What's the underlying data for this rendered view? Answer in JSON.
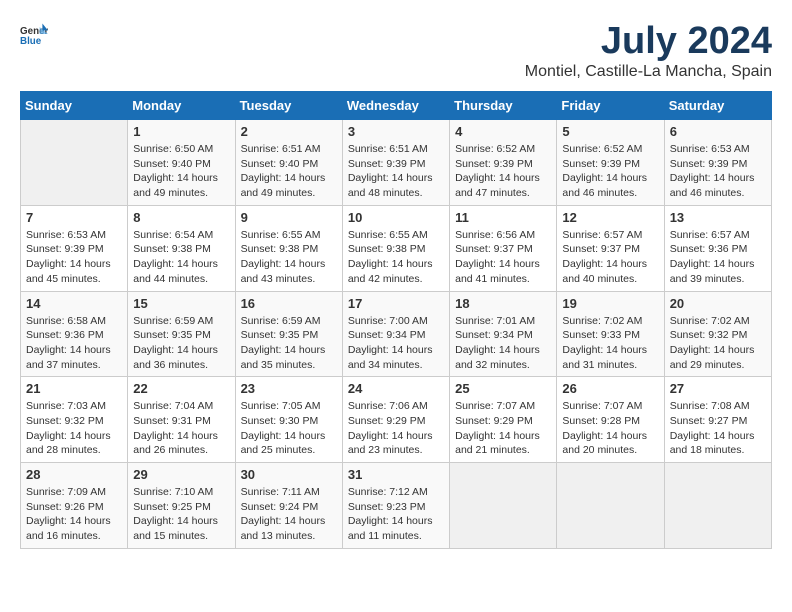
{
  "header": {
    "logo_general": "General",
    "logo_blue": "Blue",
    "month_year": "July 2024",
    "location": "Montiel, Castille-La Mancha, Spain"
  },
  "calendar": {
    "days_of_week": [
      "Sunday",
      "Monday",
      "Tuesday",
      "Wednesday",
      "Thursday",
      "Friday",
      "Saturday"
    ],
    "weeks": [
      [
        {
          "day": "",
          "info": ""
        },
        {
          "day": "1",
          "info": "Sunrise: 6:50 AM\nSunset: 9:40 PM\nDaylight: 14 hours\nand 49 minutes."
        },
        {
          "day": "2",
          "info": "Sunrise: 6:51 AM\nSunset: 9:40 PM\nDaylight: 14 hours\nand 49 minutes."
        },
        {
          "day": "3",
          "info": "Sunrise: 6:51 AM\nSunset: 9:39 PM\nDaylight: 14 hours\nand 48 minutes."
        },
        {
          "day": "4",
          "info": "Sunrise: 6:52 AM\nSunset: 9:39 PM\nDaylight: 14 hours\nand 47 minutes."
        },
        {
          "day": "5",
          "info": "Sunrise: 6:52 AM\nSunset: 9:39 PM\nDaylight: 14 hours\nand 46 minutes."
        },
        {
          "day": "6",
          "info": "Sunrise: 6:53 AM\nSunset: 9:39 PM\nDaylight: 14 hours\nand 46 minutes."
        }
      ],
      [
        {
          "day": "7",
          "info": "Sunrise: 6:53 AM\nSunset: 9:39 PM\nDaylight: 14 hours\nand 45 minutes."
        },
        {
          "day": "8",
          "info": "Sunrise: 6:54 AM\nSunset: 9:38 PM\nDaylight: 14 hours\nand 44 minutes."
        },
        {
          "day": "9",
          "info": "Sunrise: 6:55 AM\nSunset: 9:38 PM\nDaylight: 14 hours\nand 43 minutes."
        },
        {
          "day": "10",
          "info": "Sunrise: 6:55 AM\nSunset: 9:38 PM\nDaylight: 14 hours\nand 42 minutes."
        },
        {
          "day": "11",
          "info": "Sunrise: 6:56 AM\nSunset: 9:37 PM\nDaylight: 14 hours\nand 41 minutes."
        },
        {
          "day": "12",
          "info": "Sunrise: 6:57 AM\nSunset: 9:37 PM\nDaylight: 14 hours\nand 40 minutes."
        },
        {
          "day": "13",
          "info": "Sunrise: 6:57 AM\nSunset: 9:36 PM\nDaylight: 14 hours\nand 39 minutes."
        }
      ],
      [
        {
          "day": "14",
          "info": "Sunrise: 6:58 AM\nSunset: 9:36 PM\nDaylight: 14 hours\nand 37 minutes."
        },
        {
          "day": "15",
          "info": "Sunrise: 6:59 AM\nSunset: 9:35 PM\nDaylight: 14 hours\nand 36 minutes."
        },
        {
          "day": "16",
          "info": "Sunrise: 6:59 AM\nSunset: 9:35 PM\nDaylight: 14 hours\nand 35 minutes."
        },
        {
          "day": "17",
          "info": "Sunrise: 7:00 AM\nSunset: 9:34 PM\nDaylight: 14 hours\nand 34 minutes."
        },
        {
          "day": "18",
          "info": "Sunrise: 7:01 AM\nSunset: 9:34 PM\nDaylight: 14 hours\nand 32 minutes."
        },
        {
          "day": "19",
          "info": "Sunrise: 7:02 AM\nSunset: 9:33 PM\nDaylight: 14 hours\nand 31 minutes."
        },
        {
          "day": "20",
          "info": "Sunrise: 7:02 AM\nSunset: 9:32 PM\nDaylight: 14 hours\nand 29 minutes."
        }
      ],
      [
        {
          "day": "21",
          "info": "Sunrise: 7:03 AM\nSunset: 9:32 PM\nDaylight: 14 hours\nand 28 minutes."
        },
        {
          "day": "22",
          "info": "Sunrise: 7:04 AM\nSunset: 9:31 PM\nDaylight: 14 hours\nand 26 minutes."
        },
        {
          "day": "23",
          "info": "Sunrise: 7:05 AM\nSunset: 9:30 PM\nDaylight: 14 hours\nand 25 minutes."
        },
        {
          "day": "24",
          "info": "Sunrise: 7:06 AM\nSunset: 9:29 PM\nDaylight: 14 hours\nand 23 minutes."
        },
        {
          "day": "25",
          "info": "Sunrise: 7:07 AM\nSunset: 9:29 PM\nDaylight: 14 hours\nand 21 minutes."
        },
        {
          "day": "26",
          "info": "Sunrise: 7:07 AM\nSunset: 9:28 PM\nDaylight: 14 hours\nand 20 minutes."
        },
        {
          "day": "27",
          "info": "Sunrise: 7:08 AM\nSunset: 9:27 PM\nDaylight: 14 hours\nand 18 minutes."
        }
      ],
      [
        {
          "day": "28",
          "info": "Sunrise: 7:09 AM\nSunset: 9:26 PM\nDaylight: 14 hours\nand 16 minutes."
        },
        {
          "day": "29",
          "info": "Sunrise: 7:10 AM\nSunset: 9:25 PM\nDaylight: 14 hours\nand 15 minutes."
        },
        {
          "day": "30",
          "info": "Sunrise: 7:11 AM\nSunset: 9:24 PM\nDaylight: 14 hours\nand 13 minutes."
        },
        {
          "day": "31",
          "info": "Sunrise: 7:12 AM\nSunset: 9:23 PM\nDaylight: 14 hours\nand 11 minutes."
        },
        {
          "day": "",
          "info": ""
        },
        {
          "day": "",
          "info": ""
        },
        {
          "day": "",
          "info": ""
        }
      ]
    ]
  }
}
